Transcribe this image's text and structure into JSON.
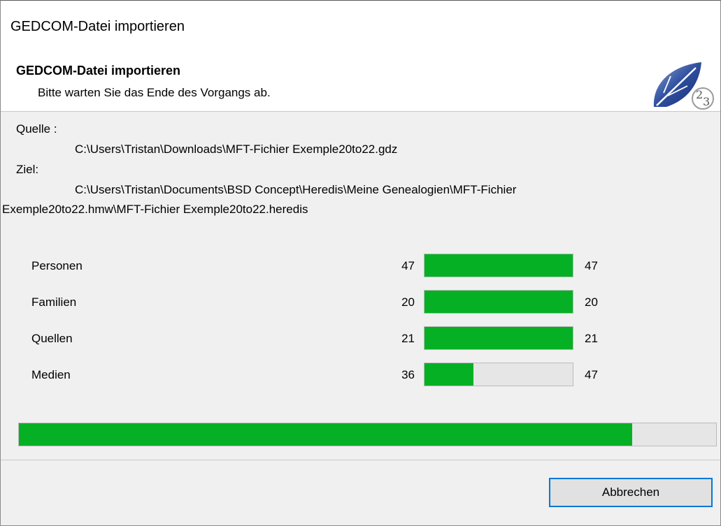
{
  "window": {
    "title": "GEDCOM-Datei importieren"
  },
  "header": {
    "title": "GEDCOM-Datei importieren",
    "subtitle": "Bitte warten Sie das Ende des Vorgangs ab.",
    "logo_icon": "heredis-leaf-2023-logo"
  },
  "source": {
    "label": "Quelle :",
    "path": "C:\\Users\\Tristan\\Downloads\\MFT-Fichier Exemple20to22.gdz"
  },
  "target": {
    "label": "Ziel:",
    "path_line1": "C:\\Users\\Tristan\\Documents\\BSD Concept\\Heredis\\Meine Genealogien\\MFT-Fichier",
    "path_line2": "Exemple20to22.hmw\\MFT-Fichier Exemple20to22.heredis"
  },
  "stats": [
    {
      "name": "Personen",
      "current": "47",
      "total": "47",
      "progress": 1.0
    },
    {
      "name": "Familien",
      "current": "20",
      "total": "20",
      "progress": 1.0
    },
    {
      "name": "Quellen",
      "current": "21",
      "total": "21",
      "progress": 1.0
    },
    {
      "name": "Medien",
      "current": "36",
      "total": "47",
      "progress": 0.33
    }
  ],
  "overall_progress": 0.88,
  "colors": {
    "progress_fill": "#06b025",
    "progress_track": "#e6e6e6",
    "button_focus_border": "#0078d7"
  },
  "buttons": {
    "cancel_label": "Abbrechen"
  }
}
